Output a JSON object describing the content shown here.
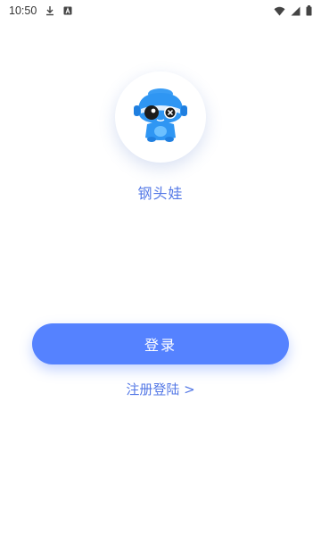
{
  "status_bar": {
    "time": "10:50",
    "left_icons": [
      "download-icon",
      "a-icon"
    ],
    "right_icons": [
      "wifi-icon",
      "signal-icon",
      "battery-icon"
    ]
  },
  "app": {
    "name": "钢头娃",
    "logo_icon": "robot-mascot-icon",
    "accent_color": "#5582ff"
  },
  "actions": {
    "login_label": "登录",
    "register_label": "注册登陆 >"
  }
}
